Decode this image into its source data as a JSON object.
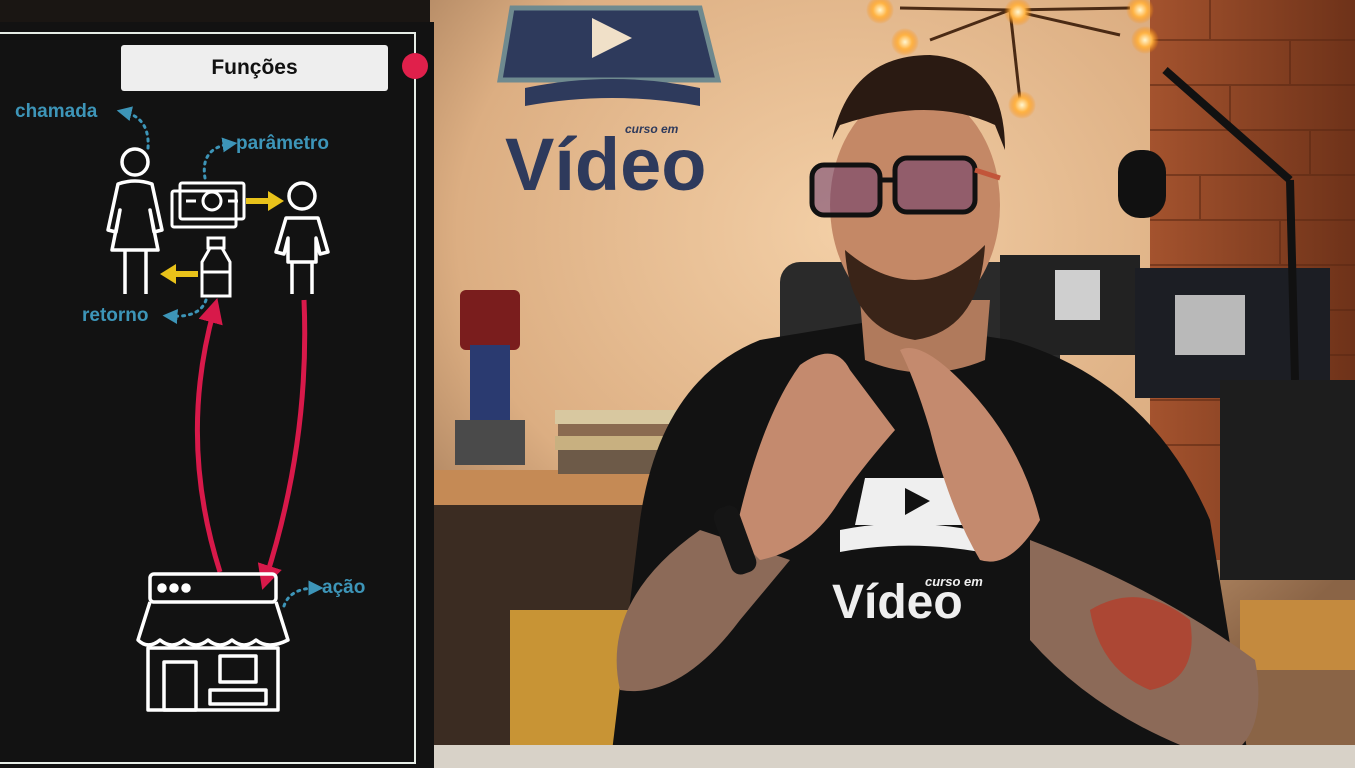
{
  "diagram": {
    "title": "Funções",
    "labels": {
      "chamada": "chamada",
      "parametro": "parâmetro",
      "retorno": "retorno",
      "acao": "ação"
    }
  },
  "video_scene": {
    "wall_logo_small": "curso em",
    "wall_logo_big": "Vídeo",
    "shirt_logo_small": "curso em",
    "shirt_logo_big": "Vídeo"
  },
  "colors": {
    "panel_bg": "#121212",
    "label_blue": "#3d95b8",
    "arrow_red": "#d8194a",
    "arrow_yellow": "#e8c21a",
    "record_dot": "#e0204b"
  },
  "icons": [
    "woman-icon",
    "money-bill-icon",
    "child-icon",
    "milk-bottle-icon",
    "store-icon"
  ]
}
